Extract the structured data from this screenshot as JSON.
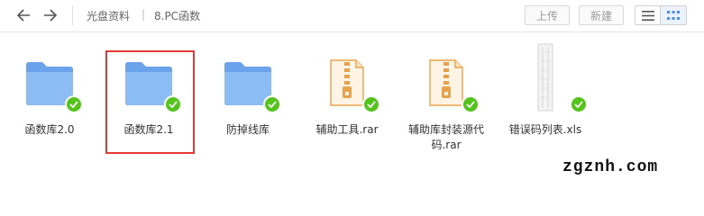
{
  "toolbar": {
    "back_icon": "arrow-left-icon",
    "forward_icon": "arrow-right-icon",
    "breadcrumb": [
      "光盘资料",
      "8.PC函数"
    ],
    "upload_label": "上传",
    "new_label": "新建",
    "list_view_icon": "list-view-icon",
    "grid_view_icon": "grid-view-icon",
    "active_view": "grid"
  },
  "files": [
    {
      "name": "函数库2.0",
      "type": "folder",
      "synced": true
    },
    {
      "name": "函数库2.1",
      "type": "folder",
      "synced": true,
      "highlighted": true
    },
    {
      "name": "防掉线库",
      "type": "folder",
      "synced": true
    },
    {
      "name": "辅助工具.rar",
      "type": "archive",
      "synced": true
    },
    {
      "name": "辅助库封装源代码.rar",
      "type": "archive",
      "synced": true
    },
    {
      "name": "错误码列表.xls",
      "type": "spreadsheet",
      "synced": true
    }
  ],
  "colors": {
    "folder": "#7fb2f0",
    "archive": "#f0b366",
    "check": "#52c41a",
    "highlight": "#e53935",
    "accent": "#4a8cf0"
  },
  "watermark": "zgznh.com"
}
